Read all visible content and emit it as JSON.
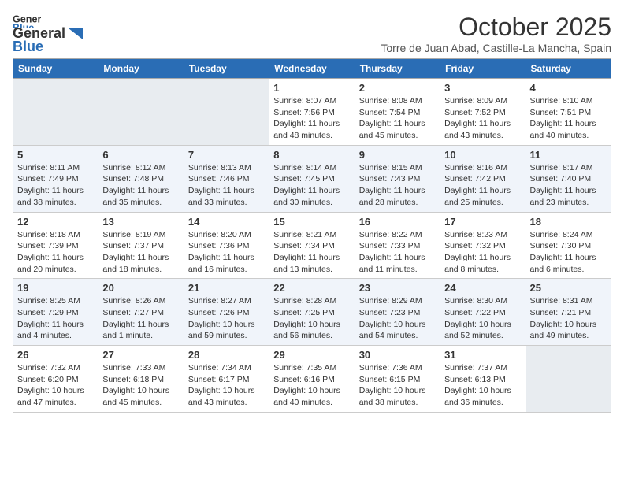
{
  "header": {
    "logo_general": "General",
    "logo_blue": "Blue",
    "month": "October 2025",
    "location": "Torre de Juan Abad, Castille-La Mancha, Spain"
  },
  "weekdays": [
    "Sunday",
    "Monday",
    "Tuesday",
    "Wednesday",
    "Thursday",
    "Friday",
    "Saturday"
  ],
  "weeks": [
    [
      {
        "day": "",
        "info": ""
      },
      {
        "day": "",
        "info": ""
      },
      {
        "day": "",
        "info": ""
      },
      {
        "day": "1",
        "info": "Sunrise: 8:07 AM\nSunset: 7:56 PM\nDaylight: 11 hours and 48 minutes."
      },
      {
        "day": "2",
        "info": "Sunrise: 8:08 AM\nSunset: 7:54 PM\nDaylight: 11 hours and 45 minutes."
      },
      {
        "day": "3",
        "info": "Sunrise: 8:09 AM\nSunset: 7:52 PM\nDaylight: 11 hours and 43 minutes."
      },
      {
        "day": "4",
        "info": "Sunrise: 8:10 AM\nSunset: 7:51 PM\nDaylight: 11 hours and 40 minutes."
      }
    ],
    [
      {
        "day": "5",
        "info": "Sunrise: 8:11 AM\nSunset: 7:49 PM\nDaylight: 11 hours and 38 minutes."
      },
      {
        "day": "6",
        "info": "Sunrise: 8:12 AM\nSunset: 7:48 PM\nDaylight: 11 hours and 35 minutes."
      },
      {
        "day": "7",
        "info": "Sunrise: 8:13 AM\nSunset: 7:46 PM\nDaylight: 11 hours and 33 minutes."
      },
      {
        "day": "8",
        "info": "Sunrise: 8:14 AM\nSunset: 7:45 PM\nDaylight: 11 hours and 30 minutes."
      },
      {
        "day": "9",
        "info": "Sunrise: 8:15 AM\nSunset: 7:43 PM\nDaylight: 11 hours and 28 minutes."
      },
      {
        "day": "10",
        "info": "Sunrise: 8:16 AM\nSunset: 7:42 PM\nDaylight: 11 hours and 25 minutes."
      },
      {
        "day": "11",
        "info": "Sunrise: 8:17 AM\nSunset: 7:40 PM\nDaylight: 11 hours and 23 minutes."
      }
    ],
    [
      {
        "day": "12",
        "info": "Sunrise: 8:18 AM\nSunset: 7:39 PM\nDaylight: 11 hours and 20 minutes."
      },
      {
        "day": "13",
        "info": "Sunrise: 8:19 AM\nSunset: 7:37 PM\nDaylight: 11 hours and 18 minutes."
      },
      {
        "day": "14",
        "info": "Sunrise: 8:20 AM\nSunset: 7:36 PM\nDaylight: 11 hours and 16 minutes."
      },
      {
        "day": "15",
        "info": "Sunrise: 8:21 AM\nSunset: 7:34 PM\nDaylight: 11 hours and 13 minutes."
      },
      {
        "day": "16",
        "info": "Sunrise: 8:22 AM\nSunset: 7:33 PM\nDaylight: 11 hours and 11 minutes."
      },
      {
        "day": "17",
        "info": "Sunrise: 8:23 AM\nSunset: 7:32 PM\nDaylight: 11 hours and 8 minutes."
      },
      {
        "day": "18",
        "info": "Sunrise: 8:24 AM\nSunset: 7:30 PM\nDaylight: 11 hours and 6 minutes."
      }
    ],
    [
      {
        "day": "19",
        "info": "Sunrise: 8:25 AM\nSunset: 7:29 PM\nDaylight: 11 hours and 4 minutes."
      },
      {
        "day": "20",
        "info": "Sunrise: 8:26 AM\nSunset: 7:27 PM\nDaylight: 11 hours and 1 minute."
      },
      {
        "day": "21",
        "info": "Sunrise: 8:27 AM\nSunset: 7:26 PM\nDaylight: 10 hours and 59 minutes."
      },
      {
        "day": "22",
        "info": "Sunrise: 8:28 AM\nSunset: 7:25 PM\nDaylight: 10 hours and 56 minutes."
      },
      {
        "day": "23",
        "info": "Sunrise: 8:29 AM\nSunset: 7:23 PM\nDaylight: 10 hours and 54 minutes."
      },
      {
        "day": "24",
        "info": "Sunrise: 8:30 AM\nSunset: 7:22 PM\nDaylight: 10 hours and 52 minutes."
      },
      {
        "day": "25",
        "info": "Sunrise: 8:31 AM\nSunset: 7:21 PM\nDaylight: 10 hours and 49 minutes."
      }
    ],
    [
      {
        "day": "26",
        "info": "Sunrise: 7:32 AM\nSunset: 6:20 PM\nDaylight: 10 hours and 47 minutes."
      },
      {
        "day": "27",
        "info": "Sunrise: 7:33 AM\nSunset: 6:18 PM\nDaylight: 10 hours and 45 minutes."
      },
      {
        "day": "28",
        "info": "Sunrise: 7:34 AM\nSunset: 6:17 PM\nDaylight: 10 hours and 43 minutes."
      },
      {
        "day": "29",
        "info": "Sunrise: 7:35 AM\nSunset: 6:16 PM\nDaylight: 10 hours and 40 minutes."
      },
      {
        "day": "30",
        "info": "Sunrise: 7:36 AM\nSunset: 6:15 PM\nDaylight: 10 hours and 38 minutes."
      },
      {
        "day": "31",
        "info": "Sunrise: 7:37 AM\nSunset: 6:13 PM\nDaylight: 10 hours and 36 minutes."
      },
      {
        "day": "",
        "info": ""
      }
    ]
  ]
}
